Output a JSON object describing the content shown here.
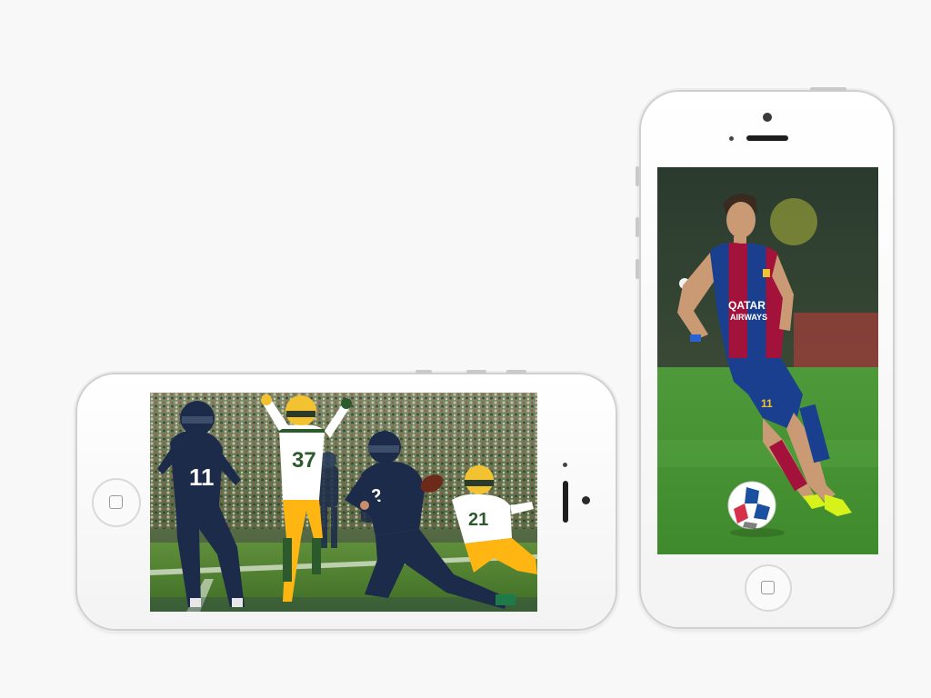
{
  "scene": {
    "background": "#f8f8f8",
    "device_color": "white"
  },
  "phone_landscape": {
    "screen_content": "american-football-photo",
    "jersey_numbers": [
      "11",
      "37",
      "82",
      "21"
    ],
    "team_colors": {
      "home": "#1c2b4a",
      "away_jersey": "#ffffff",
      "away_trim": "#ffb612",
      "away_helmet": "#f2c230"
    }
  },
  "phone_portrait": {
    "screen_content": "soccer-photo",
    "shirt_sponsor_line1": "QATAR",
    "shirt_sponsor_line2": "AIRWAYS",
    "shorts_number": "11",
    "kit_colors": {
      "blue": "#1b3f8f",
      "red": "#a3123a",
      "boots": "#d7f21b"
    }
  }
}
